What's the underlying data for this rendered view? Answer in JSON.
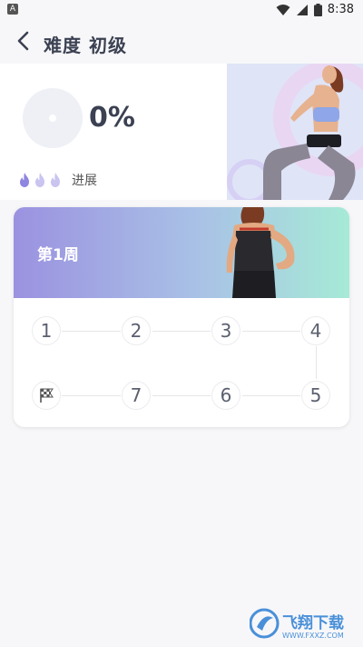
{
  "status_bar": {
    "time": "8:38",
    "app_icon_letter": "A"
  },
  "header": {
    "title": "难度 初级"
  },
  "summary": {
    "percent": "0%",
    "progress_label": "进展",
    "flame_count": 3
  },
  "plan": {
    "week_label": "第1周",
    "days_row1": [
      "1",
      "2",
      "3",
      "4"
    ],
    "days_row2": [
      "7",
      "6",
      "5"
    ]
  },
  "watermark": {
    "text": "飞翔下载",
    "url_text": "WWW.FXXZ.COM"
  },
  "colors": {
    "accent": "#8f86e0",
    "banner_start": "#9b92e0",
    "banner_end": "#a6ead6",
    "text_dark": "#3b4152"
  }
}
